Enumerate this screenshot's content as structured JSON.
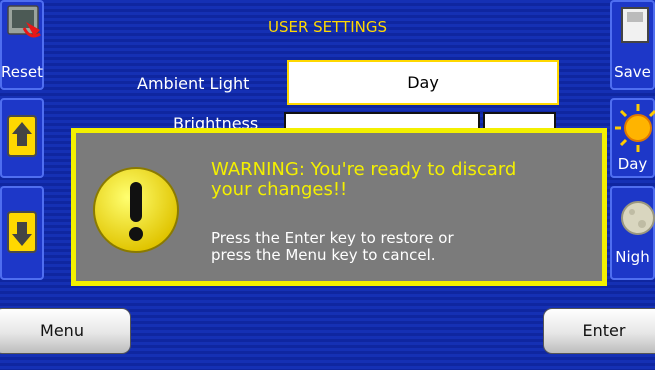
{
  "header": {
    "title": "USER SETTINGS"
  },
  "left_buttons": [
    {
      "label": "Reset",
      "icon": "reset-icon"
    },
    {
      "label": "",
      "icon": "arrow-up-icon"
    },
    {
      "label": "",
      "icon": "arrow-down-icon"
    }
  ],
  "right_buttons": [
    {
      "label": "Save",
      "icon": "save-icon"
    },
    {
      "label": "Day",
      "icon": "sun-icon"
    },
    {
      "label": "Nigh",
      "icon": "moon-icon"
    }
  ],
  "settings": {
    "ambient_label": "Ambient Light",
    "ambient_value": "Day",
    "brightness_label": "Brightness"
  },
  "dialog": {
    "warning_line1": "WARNING: You're ready to discard",
    "warning_line2": "your changes!!",
    "info_line1": "Press the Enter key to restore or",
    "info_line2": "press the Menu key to cancel."
  },
  "footer": {
    "menu_label": "Menu",
    "enter_label": "Enter"
  },
  "colors": {
    "background": "#1530b4",
    "accent": "#ffd800",
    "dialog_border": "#f3f000",
    "dialog_bg": "#7b7b7b"
  }
}
